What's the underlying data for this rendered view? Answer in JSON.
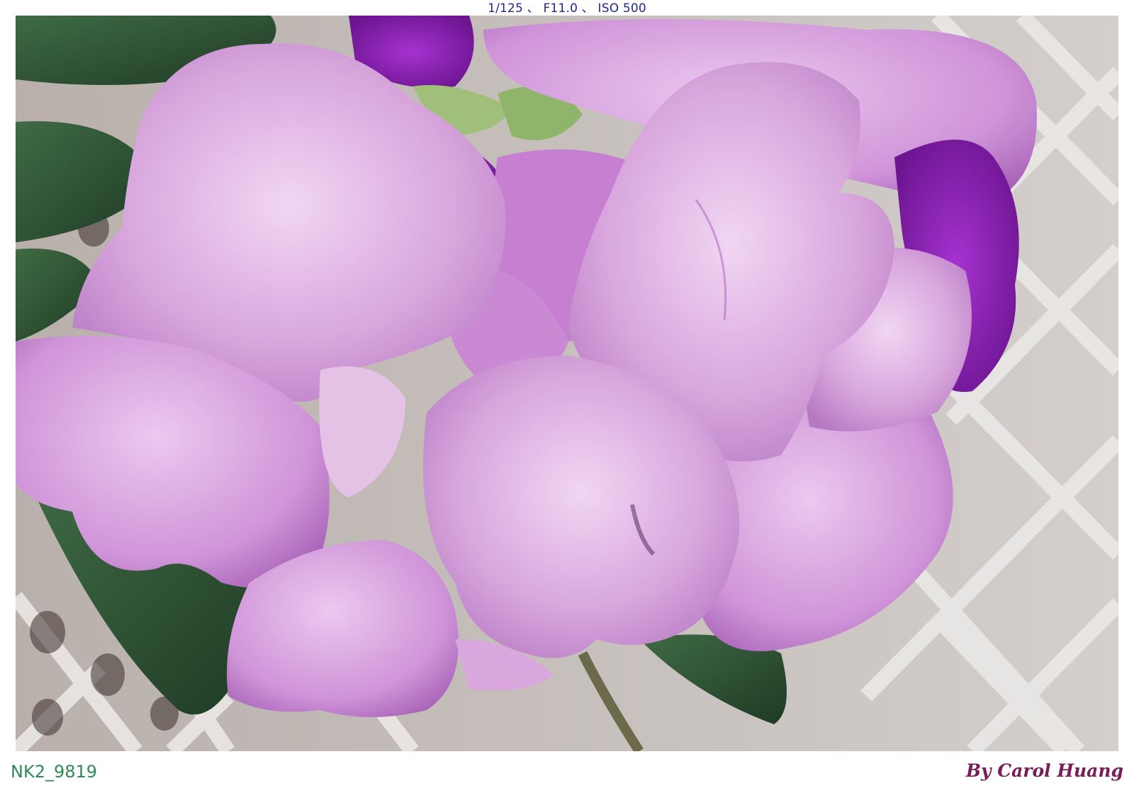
{
  "exif_info": "1/125 、 F11.0 、 ISO 500",
  "file_name": "NK2_9819",
  "credit": "By Carol Huang",
  "colors": {
    "exif_text": "#1f2a8a",
    "file_name_text": "#2f8a58",
    "credit_text": "#7a1c57",
    "petal_light": "#d9a9de",
    "petal_deep": "#8a1fb0",
    "leaf": "#2f4d33"
  }
}
